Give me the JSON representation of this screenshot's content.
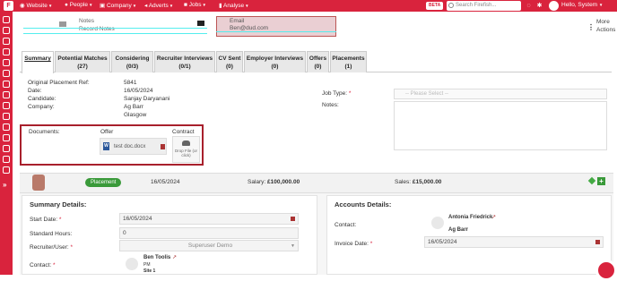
{
  "topbar": {
    "logo": "F",
    "menus": [
      {
        "label": "Website",
        "has_caret": true
      },
      {
        "label": "People",
        "has_caret": true
      },
      {
        "label": "Company",
        "has_caret": true
      },
      {
        "label": "Adverts",
        "has_caret": true
      },
      {
        "label": "Jobs",
        "has_caret": true
      },
      {
        "label": "Analyse",
        "has_caret": true
      }
    ],
    "beta": "BETA",
    "search_placeholder": "Search Firefish...",
    "greeting": "Hello, System",
    "accent_color": "#d9233d"
  },
  "header": {
    "notes_label": "Notes",
    "record_notes_label": "Record Notes",
    "email_label": "Email",
    "email_value": "Ben@dud.com",
    "more_actions": "More Actions"
  },
  "tabs": [
    {
      "label": "Summary",
      "count": ""
    },
    {
      "label": "Potential Matches",
      "count": "(27)"
    },
    {
      "label": "Considering",
      "count": "(0/3)"
    },
    {
      "label": "Recruiter Interviews",
      "count": "(0/1)"
    },
    {
      "label": "CV Sent",
      "count": "(0)"
    },
    {
      "label": "Employer Interviews",
      "count": "(0)"
    },
    {
      "label": "Offers",
      "count": "(0)"
    },
    {
      "label": "Placements",
      "count": "(1)"
    }
  ],
  "summary": {
    "original_ref_label": "Original Placement Ref:",
    "original_ref_value": "5841",
    "date_label": "Date:",
    "date_value": "16/05/2024",
    "candidate_label": "Candidate:",
    "candidate_value": "Sanjay Daryanani",
    "company_label": "Company:",
    "company_value": "Ag Barr",
    "company_location": "Glasgow",
    "job_type_label": "Job Type:",
    "job_type_placeholder": "-- Please Select --",
    "notes_label": "Notes:"
  },
  "documents": {
    "label": "Documents:",
    "offer_label": "Offer",
    "contract_label": "Contract",
    "offer_file": "test doc.docx",
    "word_icon_letter": "W",
    "upload_text": "Drop File (or click)"
  },
  "placement": {
    "status": "Placement",
    "date": "16/05/2024",
    "salary_label": "Salary:",
    "salary_value": "£100,000.00",
    "sales_label": "Sales:",
    "sales_value": "£15,000.00",
    "status_color": "#3a9a3a"
  },
  "summary_details": {
    "title": "Summary Details:",
    "start_date_label": "Start Date:",
    "start_date_value": "16/05/2024",
    "standard_hours_label": "Standard Hours:",
    "standard_hours_value": "0",
    "recruiter_label": "Recruiter/User:",
    "recruiter_value": "Superuser Demo",
    "contact_label": "Contact:",
    "contact_name": "Ben Toolis",
    "contact_role": "PM",
    "contact_site": "Site 1"
  },
  "accounts_details": {
    "title": "Accounts Details:",
    "contact_label": "Contact:",
    "contact_name": "Antonia Friedrick",
    "contact_company": "Ag Barr",
    "invoice_date_label": "Invoice Date:",
    "invoice_date_value": "16/05/2024"
  },
  "required_marker": "*"
}
